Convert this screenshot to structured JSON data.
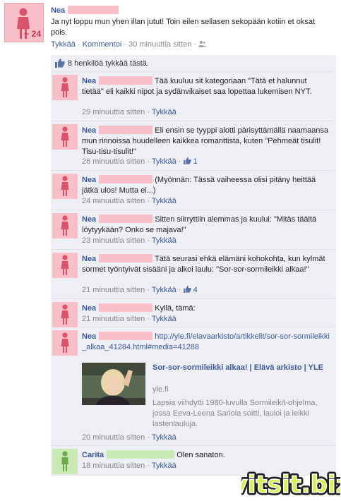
{
  "post": {
    "author": "Nea",
    "age_badge": "~ 24",
    "text": "Ja nyt loppu mun yhen illan jutut! Toin eilen sellasen sekopään kotiin et oksat pois.",
    "actions": {
      "like": "Tykkää",
      "comment": "Kommentoi",
      "time": "30 minuuttia sitten",
      "sep": "·"
    }
  },
  "likes": {
    "text": "8 henkilöä tykkää tästä.",
    "icon": "thumbs-up-icon"
  },
  "comments": [
    {
      "name": "Nea",
      "text": "Tää kuuluu sit kategoriaan \"Tätä et halunnut tietää\" eli kaikki nipot ja sydänvikaiset saa lopettaa lukemisen NYT.",
      "time": "29 minuuttia sitten",
      "like": "Tykkää",
      "like_count": ""
    },
    {
      "name": "Nea",
      "text": "Eli ensin se tyyppi alotti pärisyttämällä naamaansa mun rinnoissa huudelleen kaikkea romanttista, kuten \"Pehmeät tisulit! Tisu-tisu-tisulit!\"",
      "time": "26 minuuttia sitten",
      "like": "Tykkää",
      "like_count": "1"
    },
    {
      "name": "Nea",
      "text": "(Myönnän: Tässä vaiheessa olisi pitäny heittää jätkä ulos! Mutta ei...)",
      "time": "24 minuuttia sitten",
      "like": "Tykkää",
      "like_count": ""
    },
    {
      "name": "Nea",
      "text": "Sitten siirryttiin alemmas ja kuului: \"Mitäs täältä löytyykään? Onko se majava!\"",
      "time": "23 minuuttia sitten",
      "like": "Tykkää",
      "like_count": ""
    },
    {
      "name": "Nea",
      "text": "Tätä seurasi ehkä elämäni kohokohta, kun kylmät sormet työntyivät sisääni ja alkoi laulu: \"Sor-sor-sormileikki alkaa!\"",
      "time": "21 minuuttia sitten",
      "like": "Tykkää",
      "like_count": "4"
    },
    {
      "name": "Nea",
      "text": "Kyllä, tämä:",
      "time": "21 minuuttia sitten",
      "like": "Tykkää",
      "like_count": ""
    },
    {
      "name": "Nea",
      "text": "http://yle.fi/elavaarkisto/artikkelit/sor-sor-sormileikki_alkaa_41284.html#media=41288",
      "time": "20 minuuttia sitten",
      "like": "Tykkää",
      "like_count": "",
      "preview": {
        "title": "Sor-sor-sormileikki alkaa! | Elävä arkisto | YLE",
        "host": "yle.fi",
        "description": "Lapsia viihdytti 1980-luvulla Sormileikit-ohjelma, jossa Eeva-Leena Sariola soitti, lauloi ja leikki lastenlauluja."
      }
    },
    {
      "name": "Carita",
      "text": "Olen sanaton.",
      "time": "18 minuuttia sitten",
      "like": "Tykkää",
      "like_count": ""
    }
  ],
  "watermark": "vitsit.biz",
  "colors": {
    "link": "#3b5998",
    "female": "#f9bfc8",
    "female_icon": "#d9546b",
    "green": "#c9eab4",
    "green_icon": "#6aaa4b",
    "comment_bg": "#edeff4"
  }
}
